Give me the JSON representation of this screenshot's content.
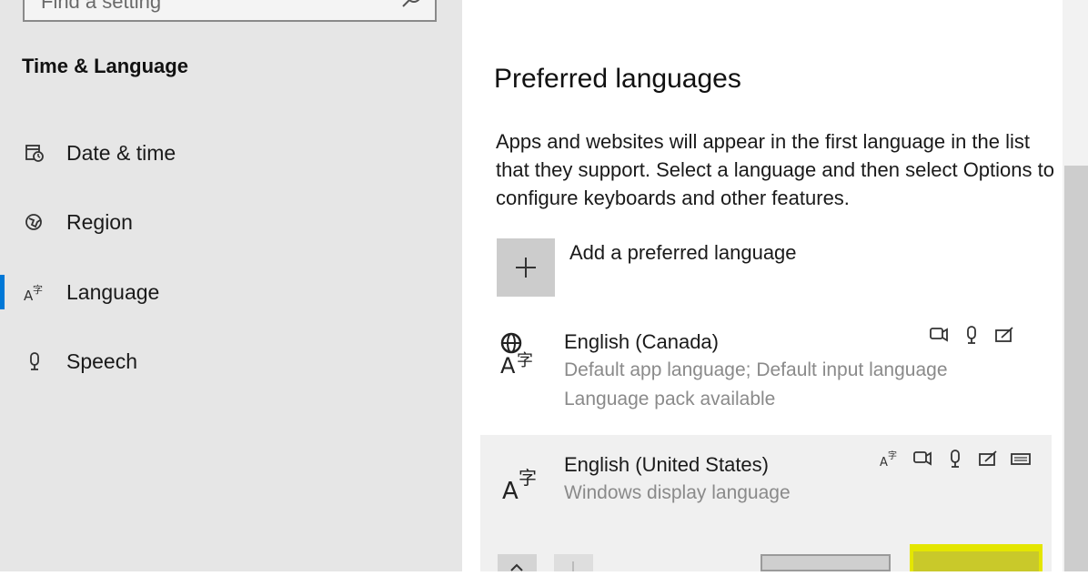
{
  "sidebar": {
    "search": {
      "placeholder": "Find a setting"
    },
    "section_title": "Time & Language",
    "items": [
      {
        "label": "Date & time",
        "icon": "calendar-clock-icon",
        "active": false
      },
      {
        "label": "Region",
        "icon": "globe-region-icon",
        "active": false
      },
      {
        "label": "Language",
        "icon": "language-icon",
        "active": true
      },
      {
        "label": "Speech",
        "icon": "microphone-icon",
        "active": false
      }
    ]
  },
  "main": {
    "title": "Preferred languages",
    "description": "Apps and websites will appear in the first language in the list that they support. Select a language and then select Options to configure keyboards and other features.",
    "add_label": "Add a preferred language",
    "languages": [
      {
        "name": "English (Canada)",
        "line1": "Default app language; Default input language",
        "line2": "Language pack available",
        "features": [
          "text-to-speech-icon",
          "microphone-icon",
          "handwriting-icon"
        ]
      },
      {
        "name": "English (United States)",
        "line1": "Windows display language",
        "features": [
          "display-language-icon",
          "text-to-speech-icon",
          "microphone-icon",
          "handwriting-icon",
          "keyboard-icon"
        ]
      }
    ]
  },
  "colors": {
    "accent": "#0078d7",
    "highlight": "#e4e600",
    "sidebar_bg": "#e6e6e6"
  }
}
